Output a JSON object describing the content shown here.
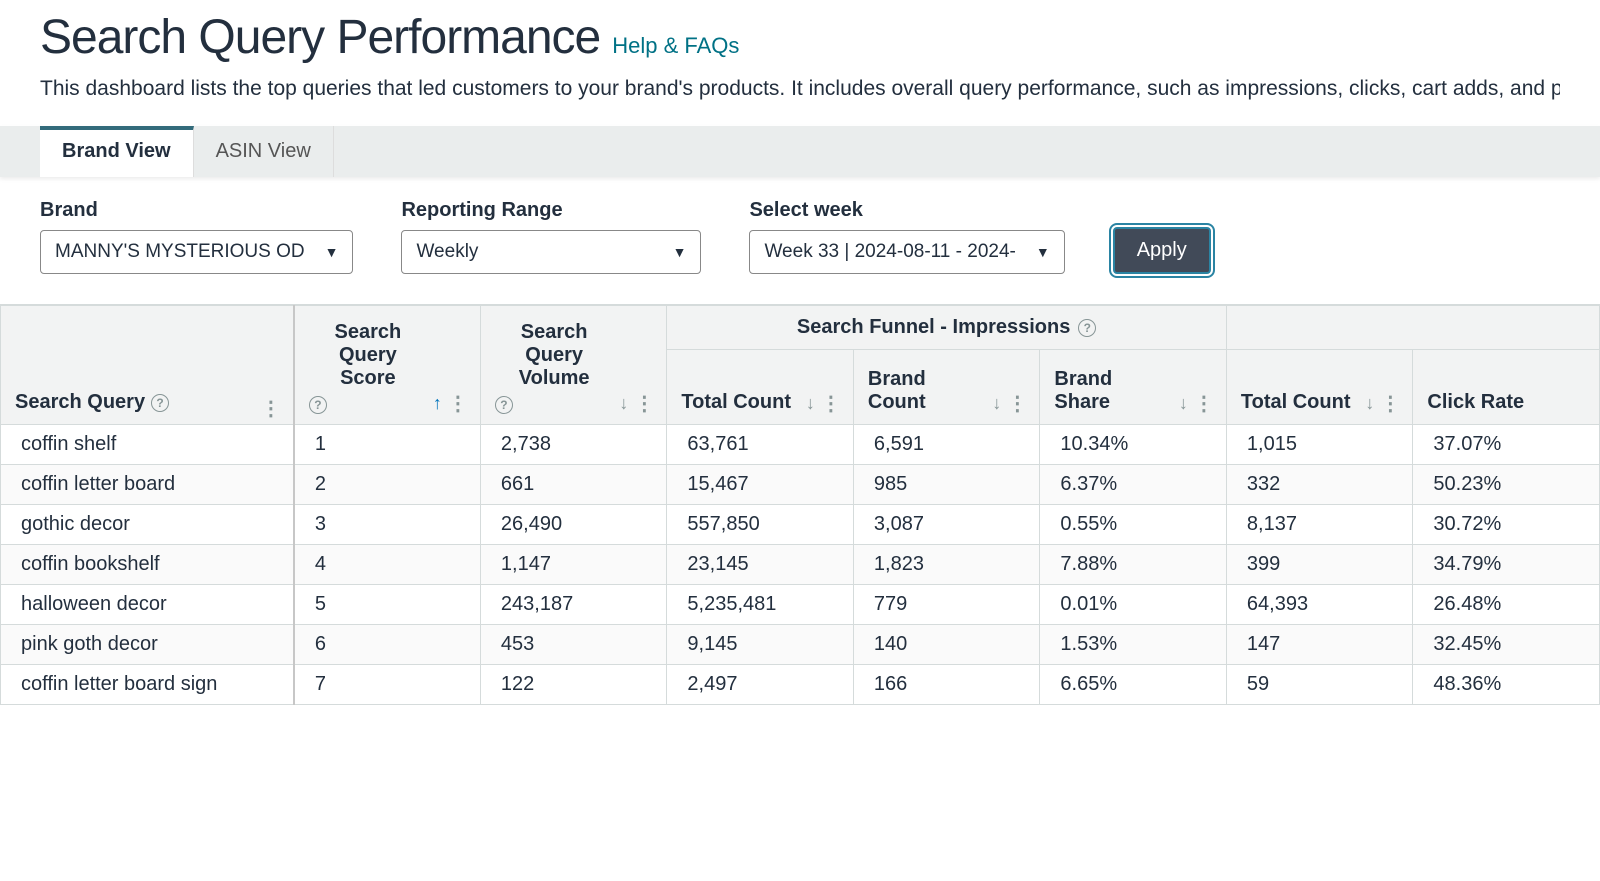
{
  "title": "Search Query Performance",
  "help_link": "Help & FAQs",
  "description": "This dashboard lists the top queries that led customers to your brand's products. It includes overall query performance, such as impressions, clicks, cart adds, and purchases of that performance. The Brand view shows query performance across your brand(s). The ASIN view shows the top search queries for a specific ASIN.",
  "tabs": {
    "brand": "Brand View",
    "asin": "ASIN View"
  },
  "filters": {
    "brand_label": "Brand",
    "brand_value": "MANNY'S MYSTERIOUS OD",
    "range_label": "Reporting Range",
    "range_value": "Weekly",
    "week_label": "Select week",
    "week_value": "Week 33 | 2024-08-11 - 2024-",
    "apply": "Apply"
  },
  "group_headers": {
    "impressions": "Search Funnel - Impressions"
  },
  "columns": {
    "query": "Search Query",
    "score": "Search Query Score",
    "volume": "Search Query Volume",
    "total_count": "Total Count",
    "brand_count": "Brand Count",
    "brand_share": "Brand Share",
    "total_count2": "Total Count",
    "click_rate": "Click Rate"
  },
  "rows": [
    {
      "query": "coffin shelf",
      "score": "1",
      "volume": "2,738",
      "tc": "63,761",
      "bc": "6,591",
      "bs": "10.34%",
      "tc2": "1,015",
      "cr": "37.07%"
    },
    {
      "query": "coffin letter board",
      "score": "2",
      "volume": "661",
      "tc": "15,467",
      "bc": "985",
      "bs": "6.37%",
      "tc2": "332",
      "cr": "50.23%"
    },
    {
      "query": "gothic decor",
      "score": "3",
      "volume": "26,490",
      "tc": "557,850",
      "bc": "3,087",
      "bs": "0.55%",
      "tc2": "8,137",
      "cr": "30.72%"
    },
    {
      "query": "coffin bookshelf",
      "score": "4",
      "volume": "1,147",
      "tc": "23,145",
      "bc": "1,823",
      "bs": "7.88%",
      "tc2": "399",
      "cr": "34.79%"
    },
    {
      "query": "halloween decor",
      "score": "5",
      "volume": "243,187",
      "tc": "5,235,481",
      "bc": "779",
      "bs": "0.01%",
      "tc2": "64,393",
      "cr": "26.48%"
    },
    {
      "query": "pink goth decor",
      "score": "6",
      "volume": "453",
      "tc": "9,145",
      "bc": "140",
      "bs": "1.53%",
      "tc2": "147",
      "cr": "32.45%"
    },
    {
      "query": "coffin letter board sign",
      "score": "7",
      "volume": "122",
      "tc": "2,497",
      "bc": "166",
      "bs": "6.65%",
      "tc2": "59",
      "cr": "48.36%"
    }
  ]
}
